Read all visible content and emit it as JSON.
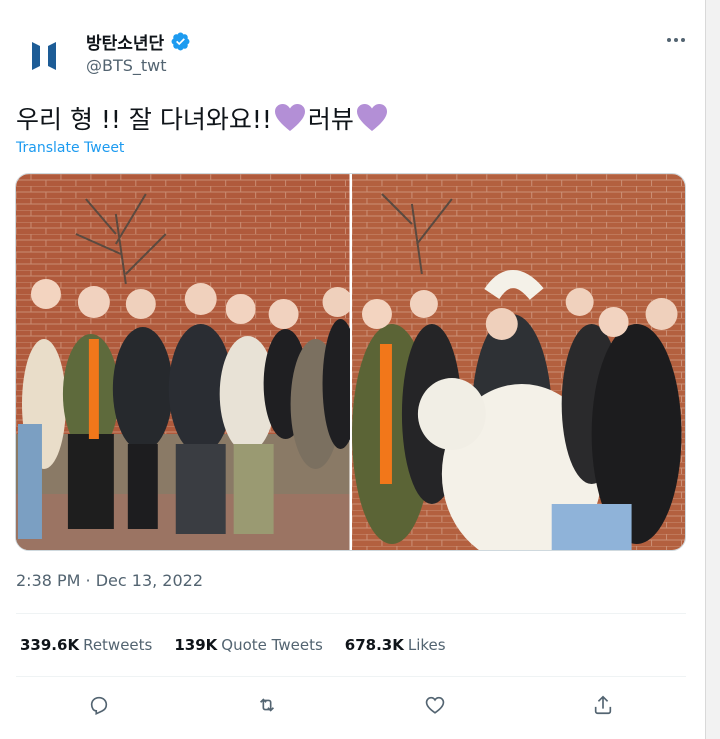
{
  "author": {
    "display_name": "방탄소년단",
    "handle": "@BTS_twt",
    "verified": true,
    "avatar_icon": "bts-logo-icon",
    "logo_color": "#1d5c96"
  },
  "menu": {
    "icon": "more-dots-icon"
  },
  "tweet": {
    "text_part1": "우리 형 !! 잘 다녀와요!!",
    "text_part2": "러뷰",
    "emoji": "purple-heart-icon",
    "emoji_color": "#b38fd6",
    "translate_label": "Translate Tweet",
    "translate_color": "#1d9bf0"
  },
  "media": {
    "photos": [
      {
        "alt": "group photo by brick wall"
      },
      {
        "alt": "group making heart with arms"
      }
    ]
  },
  "timestamp": "2:38 PM · Dec 13, 2022",
  "stats": {
    "retweets": {
      "value": "339.6K",
      "label": "Retweets"
    },
    "quotes": {
      "value": "139K",
      "label": "Quote Tweets"
    },
    "likes": {
      "value": "678.3K",
      "label": "Likes"
    }
  },
  "actions": [
    "reply-icon",
    "retweet-icon",
    "like-icon",
    "share-icon"
  ],
  "colors": {
    "text": "#0f1419",
    "secondary": "#536471",
    "accent": "#1d9bf0",
    "border": "#eff3f4"
  }
}
